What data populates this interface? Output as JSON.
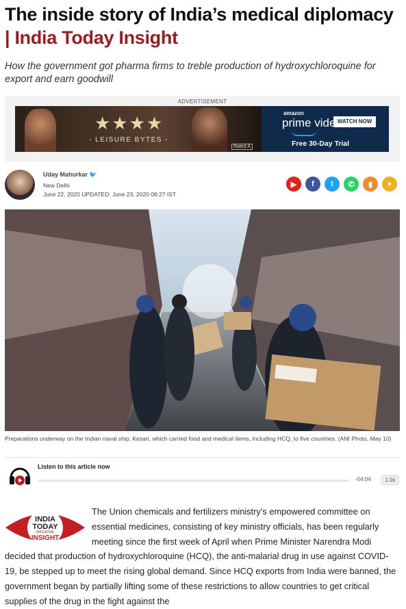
{
  "article": {
    "title_main": "The inside story of India’s medical diplomacy",
    "title_brand": "| India Today Insight",
    "subtitle": "How the government got pharma firms to treble production of hydroxychloroquine for export and earn goodwill"
  },
  "advertisement": {
    "label": "ADVERTISEMENT",
    "stars": "★★★★",
    "tagline": "- LEISURE BYTES -",
    "rating": "Rated A",
    "brand_small": "amazon",
    "brand": "prime video",
    "cta": "WATCH NOW",
    "offer": "Free 30-Day Trial"
  },
  "author": {
    "name": "Uday Mahurkar",
    "location": "New Delhi",
    "dates": "June 22, 2020 UPDATED: June 23, 2020 08:27 IST",
    "verified_icon": "twitter-bird-icon"
  },
  "share_buttons": [
    {
      "name": "youtube-icon",
      "glyph": "▶",
      "color": "#e62117"
    },
    {
      "name": "facebook-icon",
      "glyph": "f",
      "color": "#3b5998"
    },
    {
      "name": "twitter-icon",
      "glyph": "t",
      "color": "#1da1f2"
    },
    {
      "name": "whatsapp-icon",
      "glyph": "✆",
      "color": "#25d366"
    },
    {
      "name": "bookmark-icon",
      "glyph": "▮",
      "color": "#f28c28"
    },
    {
      "name": "comment-icon",
      "glyph": "●",
      "color": "#f2b01e"
    }
  ],
  "hero": {
    "caption": "Preparations underway on the Indian naval ship, Kesari, which carried food and medical items, including HCQ, to five countries. (ANI Photo, May 10)"
  },
  "audio": {
    "label": "Listen to this article now",
    "duration": "-04:04",
    "speed": "1.0x"
  },
  "logo": {
    "line1": "INDIA",
    "line2": "TODAY",
    "line3": "MAGAZINE",
    "line4": "INSIGHT"
  },
  "body": "The Union chemicals and fertilizers ministry’s empowered committee on essential medicines, consisting of key ministry officials, has been regularly meeting since the first week of April when Prime Minister Narendra Modi decided that production of hydroxychloroquine (HCQ), the anti-malarial drug in use against COVID-19, be stepped up to meet the rising global demand. Since HCQ exports from India were banned, the government began by partially lifting some of these restrictions to allow countries to get critical supplies of the drug in the fight against the"
}
